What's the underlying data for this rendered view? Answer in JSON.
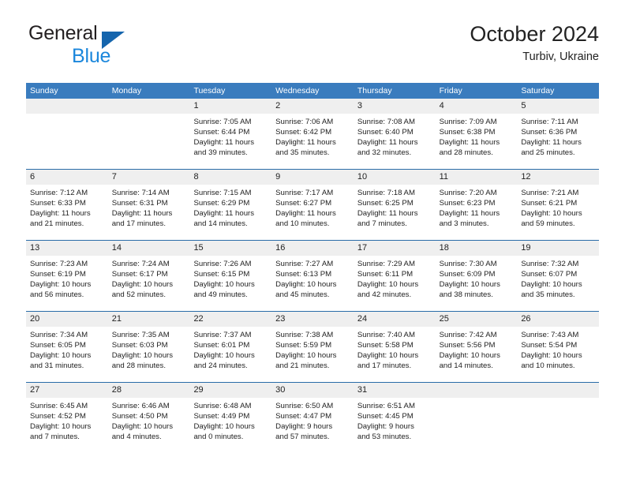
{
  "brand": {
    "name_part1": "General",
    "name_part2": "Blue",
    "logo_icon": "triangle-flag-icon"
  },
  "header": {
    "month_title": "October 2024",
    "location": "Turbiv, Ukraine"
  },
  "calendar": {
    "weekdays": [
      "Sunday",
      "Monday",
      "Tuesday",
      "Wednesday",
      "Thursday",
      "Friday",
      "Saturday"
    ],
    "colors": {
      "header_blue": "#3a7cbe",
      "row_divider_blue": "#2a6ca8",
      "date_strip_gray": "#efefef",
      "brand_blue": "#1b87dc",
      "logo_blue": "#1565ad"
    },
    "weeks": [
      {
        "days": [
          {
            "date": "",
            "sunrise": "",
            "sunset": "",
            "daylight_line1": "",
            "daylight_line2": ""
          },
          {
            "date": "",
            "sunrise": "",
            "sunset": "",
            "daylight_line1": "",
            "daylight_line2": ""
          },
          {
            "date": "1",
            "sunrise": "Sunrise: 7:05 AM",
            "sunset": "Sunset: 6:44 PM",
            "daylight_line1": "Daylight: 11 hours",
            "daylight_line2": "and 39 minutes."
          },
          {
            "date": "2",
            "sunrise": "Sunrise: 7:06 AM",
            "sunset": "Sunset: 6:42 PM",
            "daylight_line1": "Daylight: 11 hours",
            "daylight_line2": "and 35 minutes."
          },
          {
            "date": "3",
            "sunrise": "Sunrise: 7:08 AM",
            "sunset": "Sunset: 6:40 PM",
            "daylight_line1": "Daylight: 11 hours",
            "daylight_line2": "and 32 minutes."
          },
          {
            "date": "4",
            "sunrise": "Sunrise: 7:09 AM",
            "sunset": "Sunset: 6:38 PM",
            "daylight_line1": "Daylight: 11 hours",
            "daylight_line2": "and 28 minutes."
          },
          {
            "date": "5",
            "sunrise": "Sunrise: 7:11 AM",
            "sunset": "Sunset: 6:36 PM",
            "daylight_line1": "Daylight: 11 hours",
            "daylight_line2": "and 25 minutes."
          }
        ]
      },
      {
        "days": [
          {
            "date": "6",
            "sunrise": "Sunrise: 7:12 AM",
            "sunset": "Sunset: 6:33 PM",
            "daylight_line1": "Daylight: 11 hours",
            "daylight_line2": "and 21 minutes."
          },
          {
            "date": "7",
            "sunrise": "Sunrise: 7:14 AM",
            "sunset": "Sunset: 6:31 PM",
            "daylight_line1": "Daylight: 11 hours",
            "daylight_line2": "and 17 minutes."
          },
          {
            "date": "8",
            "sunrise": "Sunrise: 7:15 AM",
            "sunset": "Sunset: 6:29 PM",
            "daylight_line1": "Daylight: 11 hours",
            "daylight_line2": "and 14 minutes."
          },
          {
            "date": "9",
            "sunrise": "Sunrise: 7:17 AM",
            "sunset": "Sunset: 6:27 PM",
            "daylight_line1": "Daylight: 11 hours",
            "daylight_line2": "and 10 minutes."
          },
          {
            "date": "10",
            "sunrise": "Sunrise: 7:18 AM",
            "sunset": "Sunset: 6:25 PM",
            "daylight_line1": "Daylight: 11 hours",
            "daylight_line2": "and 7 minutes."
          },
          {
            "date": "11",
            "sunrise": "Sunrise: 7:20 AM",
            "sunset": "Sunset: 6:23 PM",
            "daylight_line1": "Daylight: 11 hours",
            "daylight_line2": "and 3 minutes."
          },
          {
            "date": "12",
            "sunrise": "Sunrise: 7:21 AM",
            "sunset": "Sunset: 6:21 PM",
            "daylight_line1": "Daylight: 10 hours",
            "daylight_line2": "and 59 minutes."
          }
        ]
      },
      {
        "days": [
          {
            "date": "13",
            "sunrise": "Sunrise: 7:23 AM",
            "sunset": "Sunset: 6:19 PM",
            "daylight_line1": "Daylight: 10 hours",
            "daylight_line2": "and 56 minutes."
          },
          {
            "date": "14",
            "sunrise": "Sunrise: 7:24 AM",
            "sunset": "Sunset: 6:17 PM",
            "daylight_line1": "Daylight: 10 hours",
            "daylight_line2": "and 52 minutes."
          },
          {
            "date": "15",
            "sunrise": "Sunrise: 7:26 AM",
            "sunset": "Sunset: 6:15 PM",
            "daylight_line1": "Daylight: 10 hours",
            "daylight_line2": "and 49 minutes."
          },
          {
            "date": "16",
            "sunrise": "Sunrise: 7:27 AM",
            "sunset": "Sunset: 6:13 PM",
            "daylight_line1": "Daylight: 10 hours",
            "daylight_line2": "and 45 minutes."
          },
          {
            "date": "17",
            "sunrise": "Sunrise: 7:29 AM",
            "sunset": "Sunset: 6:11 PM",
            "daylight_line1": "Daylight: 10 hours",
            "daylight_line2": "and 42 minutes."
          },
          {
            "date": "18",
            "sunrise": "Sunrise: 7:30 AM",
            "sunset": "Sunset: 6:09 PM",
            "daylight_line1": "Daylight: 10 hours",
            "daylight_line2": "and 38 minutes."
          },
          {
            "date": "19",
            "sunrise": "Sunrise: 7:32 AM",
            "sunset": "Sunset: 6:07 PM",
            "daylight_line1": "Daylight: 10 hours",
            "daylight_line2": "and 35 minutes."
          }
        ]
      },
      {
        "days": [
          {
            "date": "20",
            "sunrise": "Sunrise: 7:34 AM",
            "sunset": "Sunset: 6:05 PM",
            "daylight_line1": "Daylight: 10 hours",
            "daylight_line2": "and 31 minutes."
          },
          {
            "date": "21",
            "sunrise": "Sunrise: 7:35 AM",
            "sunset": "Sunset: 6:03 PM",
            "daylight_line1": "Daylight: 10 hours",
            "daylight_line2": "and 28 minutes."
          },
          {
            "date": "22",
            "sunrise": "Sunrise: 7:37 AM",
            "sunset": "Sunset: 6:01 PM",
            "daylight_line1": "Daylight: 10 hours",
            "daylight_line2": "and 24 minutes."
          },
          {
            "date": "23",
            "sunrise": "Sunrise: 7:38 AM",
            "sunset": "Sunset: 5:59 PM",
            "daylight_line1": "Daylight: 10 hours",
            "daylight_line2": "and 21 minutes."
          },
          {
            "date": "24",
            "sunrise": "Sunrise: 7:40 AM",
            "sunset": "Sunset: 5:58 PM",
            "daylight_line1": "Daylight: 10 hours",
            "daylight_line2": "and 17 minutes."
          },
          {
            "date": "25",
            "sunrise": "Sunrise: 7:42 AM",
            "sunset": "Sunset: 5:56 PM",
            "daylight_line1": "Daylight: 10 hours",
            "daylight_line2": "and 14 minutes."
          },
          {
            "date": "26",
            "sunrise": "Sunrise: 7:43 AM",
            "sunset": "Sunset: 5:54 PM",
            "daylight_line1": "Daylight: 10 hours",
            "daylight_line2": "and 10 minutes."
          }
        ]
      },
      {
        "days": [
          {
            "date": "27",
            "sunrise": "Sunrise: 6:45 AM",
            "sunset": "Sunset: 4:52 PM",
            "daylight_line1": "Daylight: 10 hours",
            "daylight_line2": "and 7 minutes."
          },
          {
            "date": "28",
            "sunrise": "Sunrise: 6:46 AM",
            "sunset": "Sunset: 4:50 PM",
            "daylight_line1": "Daylight: 10 hours",
            "daylight_line2": "and 4 minutes."
          },
          {
            "date": "29",
            "sunrise": "Sunrise: 6:48 AM",
            "sunset": "Sunset: 4:49 PM",
            "daylight_line1": "Daylight: 10 hours",
            "daylight_line2": "and 0 minutes."
          },
          {
            "date": "30",
            "sunrise": "Sunrise: 6:50 AM",
            "sunset": "Sunset: 4:47 PM",
            "daylight_line1": "Daylight: 9 hours",
            "daylight_line2": "and 57 minutes."
          },
          {
            "date": "31",
            "sunrise": "Sunrise: 6:51 AM",
            "sunset": "Sunset: 4:45 PM",
            "daylight_line1": "Daylight: 9 hours",
            "daylight_line2": "and 53 minutes."
          },
          {
            "date": "",
            "sunrise": "",
            "sunset": "",
            "daylight_line1": "",
            "daylight_line2": ""
          },
          {
            "date": "",
            "sunrise": "",
            "sunset": "",
            "daylight_line1": "",
            "daylight_line2": ""
          }
        ]
      }
    ]
  }
}
